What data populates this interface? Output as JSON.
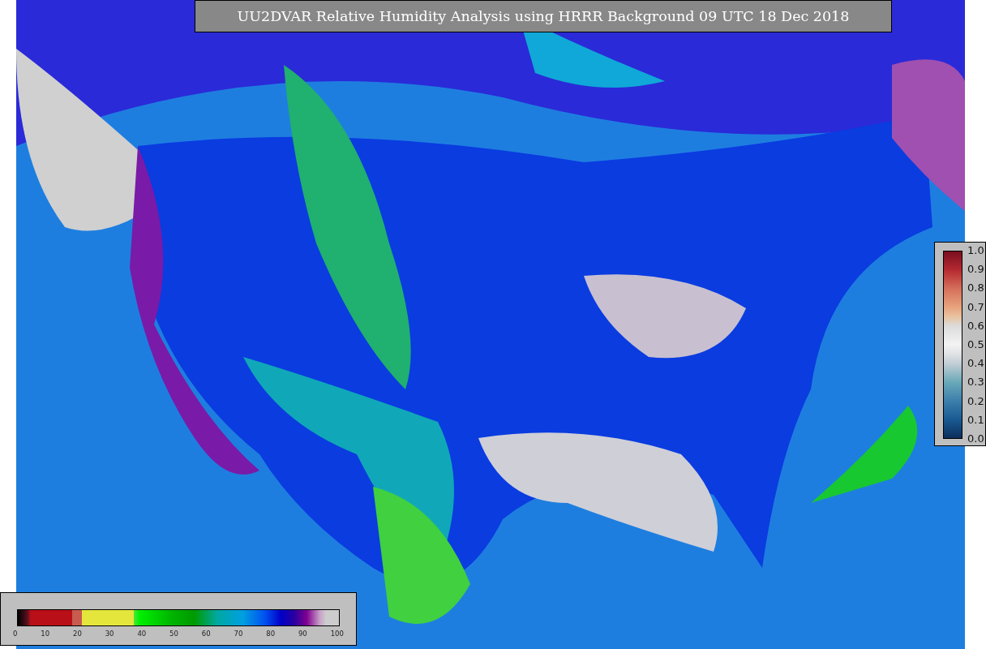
{
  "title": "UU2DVAR Relative Humidity Analysis using HRRR Background 09 UTC 18 Dec 2018",
  "error_colorbar": {
    "ticks": [
      "1.0",
      "0.9",
      "0.8",
      "0.7",
      "0.6",
      "0.5",
      "0.4",
      "0.3",
      "0.2",
      "0.1",
      "0.0"
    ]
  },
  "humidity_colorbar": {
    "ticks": [
      "0",
      "10",
      "20",
      "30",
      "40",
      "50",
      "60",
      "70",
      "80",
      "90",
      "100"
    ]
  }
}
